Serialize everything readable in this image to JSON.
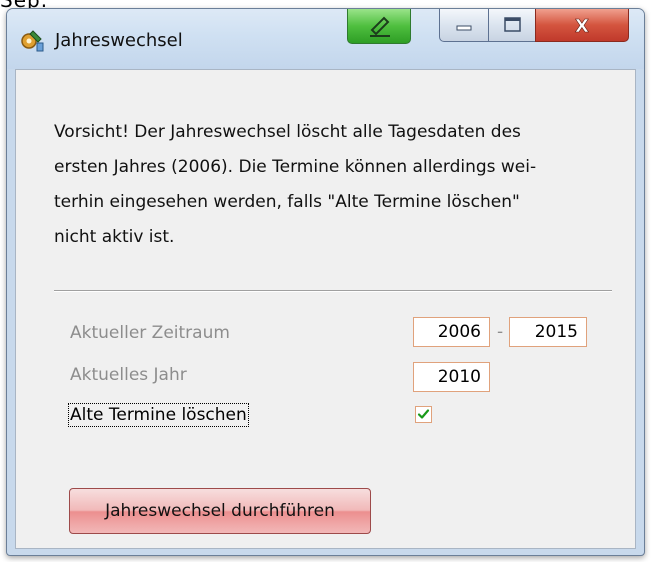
{
  "clipped_top_text": "Sep.",
  "window": {
    "title": "Jahreswechsel",
    "icons": {
      "app": "gear-tools-icon",
      "green_button": "edit-icon",
      "minimize": "minimize-icon",
      "maximize": "maximize-icon",
      "close": "close-icon"
    },
    "close_label": "X"
  },
  "message": {
    "lines": [
      "Vorsicht! Der Jahreswechsel löscht alle Tagesdaten des",
      "ersten Jahres (2006). Die Termine können allerdings wei-",
      "terhin eingesehen werden, falls \"Alte Termine löschen\"",
      "nicht aktiv ist."
    ]
  },
  "form": {
    "current_period": {
      "label": "Aktueller Zeitraum",
      "from": "2006",
      "separator": "-",
      "to": "2015"
    },
    "current_year": {
      "label": "Aktuelles Jahr",
      "value": "2010"
    },
    "delete_old": {
      "label": "Alte Termine löschen",
      "checked": true
    }
  },
  "action_button": {
    "mnemonic": "J",
    "rest": "ahreswechsel durchführen"
  },
  "colors": {
    "field_border": "#e0a27c",
    "check_green": "#1a9a1a",
    "button_red": "#ec8f8f"
  }
}
